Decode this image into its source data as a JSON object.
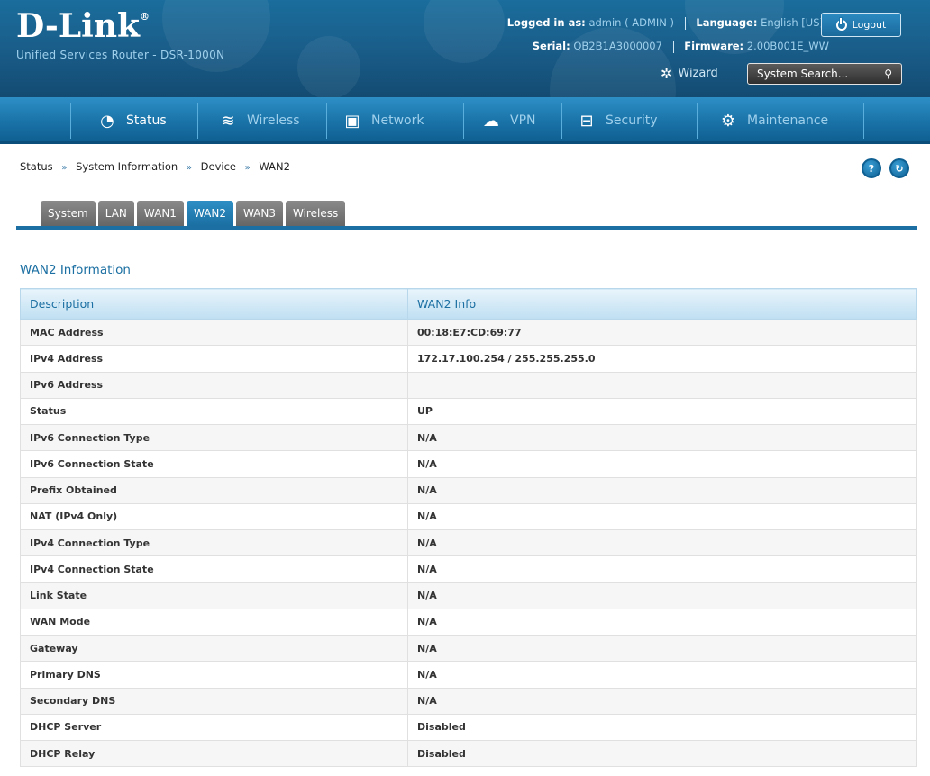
{
  "brand": {
    "logo_text": "D-Link",
    "logo_mark": "®",
    "subtitle": "Unified Services Router - DSR-1000N"
  },
  "session": {
    "logged_in_label": "Logged in as:",
    "logged_in_value": "admin ( ADMIN )",
    "language_label": "Language:",
    "language_value": "English [US]",
    "serial_label": "Serial:",
    "serial_value": "QB2B1A3000007",
    "firmware_label": "Firmware:",
    "firmware_value": "2.00B001E_WW",
    "logout_label": "Logout"
  },
  "tools": {
    "wizard_label": "Wizard",
    "search_placeholder": "System Search..."
  },
  "nav": {
    "items": [
      {
        "label": "Status",
        "icon": "gauge-icon"
      },
      {
        "label": "Wireless",
        "icon": "wifi-icon"
      },
      {
        "label": "Network",
        "icon": "monitor-icon"
      },
      {
        "label": "VPN",
        "icon": "cloud-lock-icon"
      },
      {
        "label": "Security",
        "icon": "lock-icon"
      },
      {
        "label": "Maintenance",
        "icon": "gears-icon"
      }
    ],
    "active": "Status"
  },
  "breadcrumb": {
    "items": [
      "Status",
      "System Information",
      "Device",
      "WAN2"
    ],
    "separator": "»"
  },
  "tabs": {
    "items": [
      "System",
      "LAN",
      "WAN1",
      "WAN2",
      "WAN3",
      "Wireless"
    ],
    "active": "WAN2"
  },
  "section": {
    "title": "WAN2 Information",
    "columns": [
      "Description",
      "WAN2 Info"
    ],
    "rows": [
      [
        "MAC Address",
        "00:18:E7:CD:69:77"
      ],
      [
        "IPv4 Address",
        "172.17.100.254 / 255.255.255.0"
      ],
      [
        "IPv6 Address",
        ""
      ],
      [
        "Status",
        "UP"
      ],
      [
        "IPv6 Connection Type",
        "N/A"
      ],
      [
        "IPv6 Connection State",
        "N/A"
      ],
      [
        "Prefix Obtained",
        "N/A"
      ],
      [
        "NAT (IPv4 Only)",
        "N/A"
      ],
      [
        "IPv4 Connection Type",
        "N/A"
      ],
      [
        "IPv4 Connection State",
        "N/A"
      ],
      [
        "Link State",
        "N/A"
      ],
      [
        "WAN Mode",
        "N/A"
      ],
      [
        "Gateway",
        "N/A"
      ],
      [
        "Primary DNS",
        "N/A"
      ],
      [
        "Secondary DNS",
        "N/A"
      ],
      [
        "DHCP Server",
        "Disabled"
      ],
      [
        "DHCP Relay",
        "Disabled"
      ]
    ]
  },
  "colors": {
    "header_bg": "#1a5f8c",
    "nav_bg": "#1a73a8",
    "accent": "#1b6fa2",
    "tab_inactive": "#777777"
  }
}
